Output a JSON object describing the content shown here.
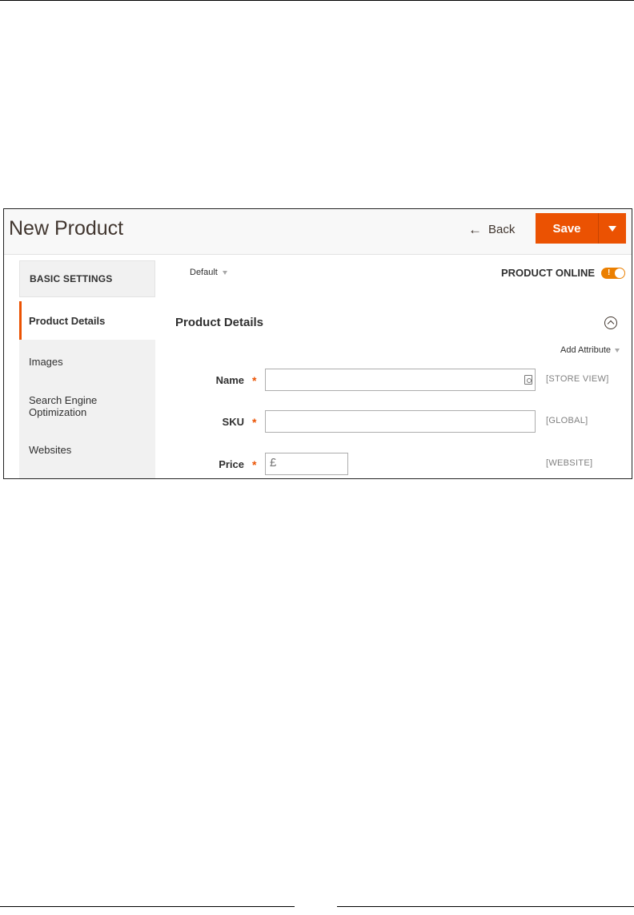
{
  "header": {
    "title": "New Product",
    "back_label": "Back",
    "back_icon": "arrow-left-icon",
    "save_label": "Save"
  },
  "colors": {
    "accent": "#eb5202",
    "toggle": "#eb7f00",
    "title": "#41362f"
  },
  "sidebar": {
    "heading": "BASIC SETTINGS",
    "items": [
      {
        "label": "Product Details",
        "active": true
      },
      {
        "label": "Images",
        "active": false
      },
      {
        "label": "Search Engine Optimization",
        "active": false
      },
      {
        "label": "Websites",
        "active": false
      }
    ]
  },
  "toolbar": {
    "scope_label": "Default",
    "online_label": "PRODUCT ONLINE",
    "online_state": "on"
  },
  "section": {
    "title": "Product Details",
    "add_attribute_label": "Add Attribute"
  },
  "fields": [
    {
      "label": "Name",
      "required": true,
      "value": "",
      "scope": "[STORE VIEW]"
    },
    {
      "label": "SKU",
      "required": true,
      "value": "",
      "scope": "[GLOBAL]"
    },
    {
      "label": "Price",
      "required": true,
      "value": "",
      "prefix": "£",
      "scope": "[WEBSITE]"
    }
  ]
}
